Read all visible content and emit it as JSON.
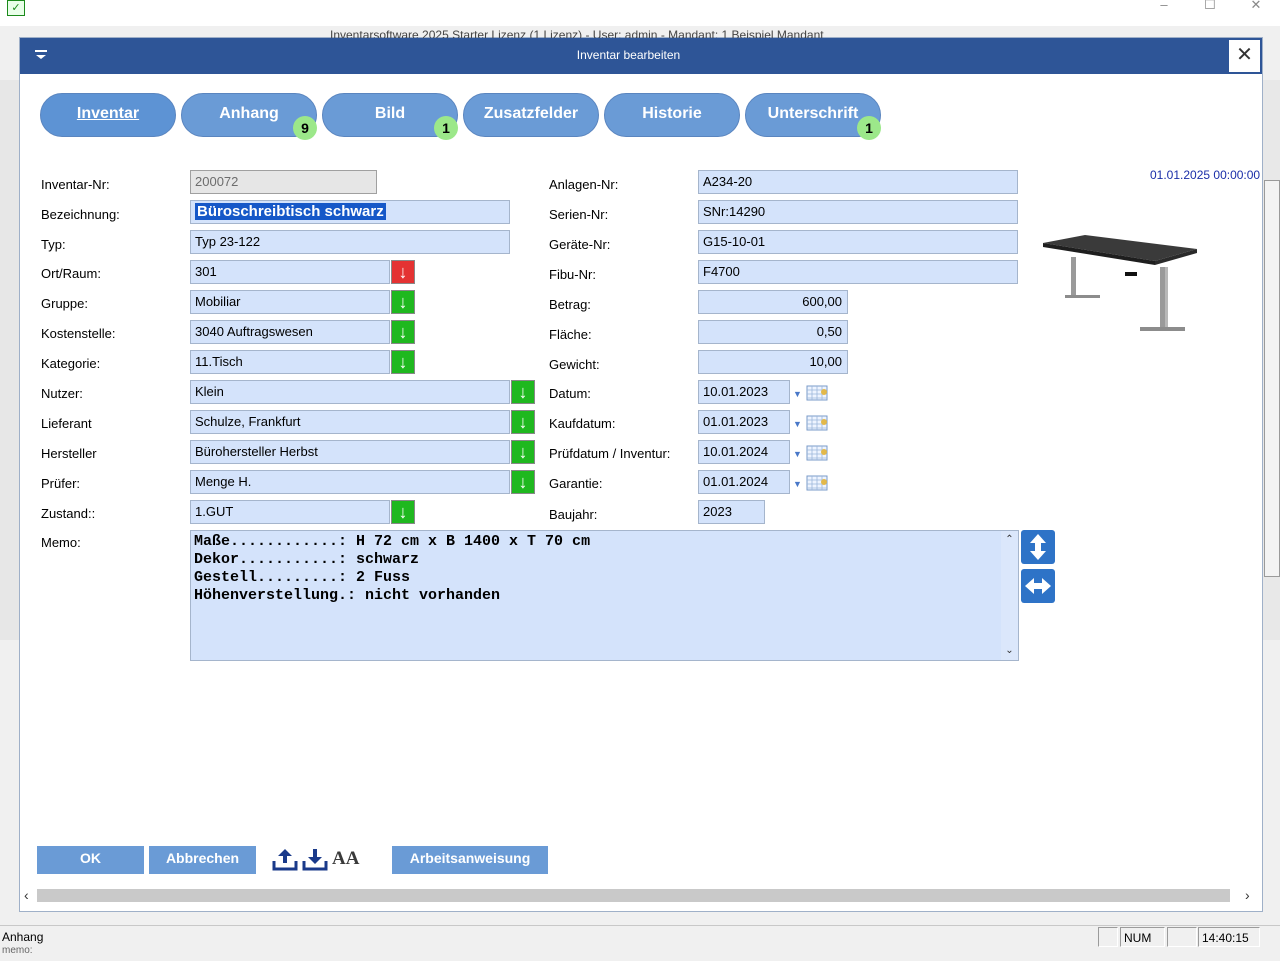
{
  "app": {
    "title": "Inventarsoftware 2025 Starter Lizenz (1 Lizenz) - User: admin - Mandant: 1 Beispiel Mandant",
    "icon": "checkmark-icon"
  },
  "dialog": {
    "title": "Inventar bearbeiten",
    "close": "✕"
  },
  "tabs": [
    {
      "label": "Inventar",
      "badge": null
    },
    {
      "label": "Anhang",
      "badge": "9"
    },
    {
      "label": "Bild",
      "badge": "1"
    },
    {
      "label": "Zusatzfelder",
      "badge": null
    },
    {
      "label": "Historie",
      "badge": null
    },
    {
      "label": "Unterschrift",
      "badge": "1"
    }
  ],
  "left_fields": {
    "inventar_nr": {
      "label": "Inventar-Nr:",
      "value": "200072"
    },
    "bezeichnung": {
      "label": "Bezeichnung:",
      "value": "Büroschreibtisch  schwarz"
    },
    "typ": {
      "label": "Typ:",
      "value": "Typ 23-122"
    },
    "ort_raum": {
      "label": "Ort/Raum:",
      "value": "301"
    },
    "gruppe": {
      "label": "Gruppe:",
      "value": "Mobiliar"
    },
    "kostenstelle": {
      "label": "Kostenstelle:",
      "value": "3040 Auftragswesen"
    },
    "kategorie": {
      "label": "Kategorie:",
      "value": "11.Tisch"
    },
    "nutzer": {
      "label": "Nutzer:",
      "value": "Klein"
    },
    "lieferant": {
      "label": "Lieferant",
      "value": "Schulze, Frankfurt"
    },
    "hersteller": {
      "label": "Hersteller",
      "value": "Bürohersteller Herbst"
    },
    "pruefer": {
      "label": "Prüfer:",
      "value": "Menge H."
    },
    "zustand": {
      "label": "Zustand::",
      "value": "1.GUT"
    },
    "memo": {
      "label": "Memo:"
    }
  },
  "right_fields": {
    "anlagen_nr": {
      "label": "Anlagen-Nr:",
      "value": "A234-20"
    },
    "serien_nr": {
      "label": "Serien-Nr:",
      "value": "SNr:14290"
    },
    "geraete_nr": {
      "label": "Geräte-Nr:",
      "value": "G15-10-01"
    },
    "fibu_nr": {
      "label": "Fibu-Nr:",
      "value": "F4700"
    },
    "betrag": {
      "label": "Betrag:",
      "value": "600,00"
    },
    "flaeche": {
      "label": "Fläche:",
      "value": "0,50"
    },
    "gewicht": {
      "label": "Gewicht:",
      "value": "10,00"
    },
    "datum": {
      "label": "Datum:",
      "value": "10.01.2023"
    },
    "kaufdatum": {
      "label": "Kaufdatum:",
      "value": "01.01.2023"
    },
    "pruefdatum": {
      "label": "Prüfdatum / Inventur:",
      "value": "10.01.2024"
    },
    "garantie": {
      "label": "Garantie:",
      "value": "01.01.2024"
    },
    "baujahr": {
      "label": "Baujahr:",
      "value": "2023"
    }
  },
  "date_stamp": "01.01.2025 00:00:00",
  "memo_lines": [
    "Maße............: H 72 cm x B 1400 x T 70 cm",
    "Dekor...........: schwarz",
    "Gestell.........: 2 Fuss",
    "Höhenverstellung.: nicht vorhanden"
  ],
  "buttons": {
    "ok": "OK",
    "abbrechen": "Abbrechen",
    "arbeitsanweisung": "Arbeitsanweisung",
    "font_label": "AA"
  },
  "statusbar": {
    "text": "Anhang",
    "memo_fragment": "memo:",
    "num": "NUM",
    "time": "14:40:15"
  },
  "colors": {
    "titlebar": "#2e5597",
    "tab": "#6a9bd6",
    "field": "#d4e3fb",
    "green_arrow": "#1fb81f",
    "red_arrow": "#e43232",
    "badge": "#9ce88a"
  }
}
